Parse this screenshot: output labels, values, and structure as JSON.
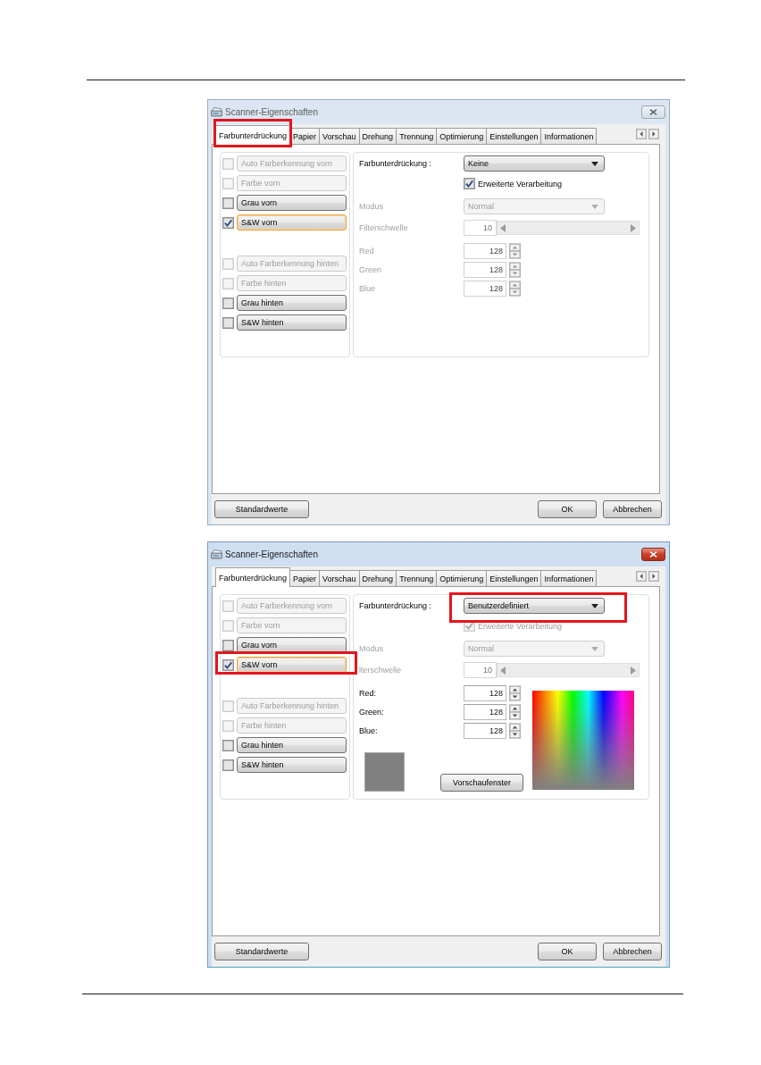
{
  "dialogs": [
    {
      "title": "Scanner-Eigenschaften",
      "active": false,
      "tabs": [
        {
          "label": "Farbunterdrückung",
          "selected": true,
          "highlighted": true
        },
        {
          "label": "Papier",
          "selected": false,
          "highlighted": false
        },
        {
          "label": "Vorschau",
          "selected": false,
          "highlighted": false
        },
        {
          "label": "Drehung",
          "selected": false,
          "highlighted": false
        },
        {
          "label": "Trennung",
          "selected": false,
          "highlighted": false
        },
        {
          "label": "Optimierung",
          "selected": false,
          "highlighted": false
        },
        {
          "label": "Einstellungen",
          "selected": false,
          "highlighted": false
        },
        {
          "label": "Informationen",
          "selected": false,
          "highlighted": false
        }
      ],
      "option_groups": [
        {
          "items": [
            {
              "label": "Auto Farberkennung vorn",
              "checked": false,
              "disabled": true,
              "focused": false,
              "highlighted": false
            },
            {
              "label": "Farbe vorn",
              "checked": false,
              "disabled": true,
              "focused": false,
              "highlighted": false
            },
            {
              "label": "Grau vorn",
              "checked": false,
              "disabled": false,
              "focused": false,
              "highlighted": false
            },
            {
              "label": "S&W vorn",
              "checked": true,
              "disabled": false,
              "focused": true,
              "highlighted": false
            }
          ]
        },
        {
          "items": [
            {
              "label": "Auto Farberkennung hinten",
              "checked": false,
              "disabled": true,
              "focused": false,
              "highlighted": false
            },
            {
              "label": "Farbe hinten",
              "checked": false,
              "disabled": true,
              "focused": false,
              "highlighted": false
            },
            {
              "label": "Grau hinten",
              "checked": false,
              "disabled": false,
              "focused": false,
              "highlighted": false
            },
            {
              "label": "S&W hinten",
              "checked": false,
              "disabled": false,
              "focused": false,
              "highlighted": false
            }
          ]
        }
      ],
      "suppression": {
        "label": "Farbunterdrückung :",
        "value": "Keine",
        "highlighted": false
      },
      "advanced": {
        "label": "Erweiterte Verarbeitung",
        "checked": true,
        "disabled": false
      },
      "mode": {
        "label": "Modus",
        "value": "Normal",
        "disabled": true
      },
      "threshold": {
        "label": "Filterschwelle",
        "value": "10",
        "disabled": true
      },
      "channels": [
        {
          "label": "Red",
          "value": "128",
          "disabled": true
        },
        {
          "label": "Green",
          "value": "128",
          "disabled": true
        },
        {
          "label": "Blue",
          "value": "128",
          "disabled": true
        }
      ],
      "buttons": [
        "Standardwerte",
        "OK",
        "Abbrechen"
      ]
    },
    {
      "title": "Scanner-Eigenschaften",
      "active": true,
      "tabs": [
        {
          "label": "Farbunterdrückung",
          "selected": true,
          "highlighted": false
        },
        {
          "label": "Papier",
          "selected": false,
          "highlighted": false
        },
        {
          "label": "Vorschau",
          "selected": false,
          "highlighted": false
        },
        {
          "label": "Drehung",
          "selected": false,
          "highlighted": false
        },
        {
          "label": "Trennung",
          "selected": false,
          "highlighted": false
        },
        {
          "label": "Optimierung",
          "selected": false,
          "highlighted": false
        },
        {
          "label": "Einstellungen",
          "selected": false,
          "highlighted": false
        },
        {
          "label": "Informationen",
          "selected": false,
          "highlighted": false
        }
      ],
      "option_groups": [
        {
          "items": [
            {
              "label": "Auto Farberkennung vorn",
              "checked": false,
              "disabled": true,
              "focused": false,
              "highlighted": false
            },
            {
              "label": "Farbe vorn",
              "checked": false,
              "disabled": true,
              "focused": false,
              "highlighted": false
            },
            {
              "label": "Grau vorn",
              "checked": false,
              "disabled": false,
              "focused": false,
              "highlighted": false
            },
            {
              "label": "S&W vorn",
              "checked": true,
              "disabled": false,
              "focused": true,
              "highlighted": true
            }
          ]
        },
        {
          "items": [
            {
              "label": "Auto Farberkennung hinten",
              "checked": false,
              "disabled": true,
              "focused": false,
              "highlighted": false
            },
            {
              "label": "Farbe hinten",
              "checked": false,
              "disabled": true,
              "focused": false,
              "highlighted": false
            },
            {
              "label": "Grau hinten",
              "checked": false,
              "disabled": false,
              "focused": false,
              "highlighted": false
            },
            {
              "label": "S&W hinten",
              "checked": false,
              "disabled": false,
              "focused": false,
              "highlighted": false
            }
          ]
        }
      ],
      "suppression": {
        "label": "Farbunterdrückung :",
        "value": "Benutzerdefiniert",
        "highlighted": true
      },
      "advanced": {
        "label": "Erweiterte Verarbeitung",
        "checked": true,
        "disabled": true
      },
      "mode": {
        "label": "Modus",
        "value": "Normal",
        "disabled": true
      },
      "threshold": {
        "label": "lterschwelle",
        "value": "10",
        "disabled": true
      },
      "channels": [
        {
          "label": "Red:",
          "value": "128",
          "disabled": false
        },
        {
          "label": "Green:",
          "value": "128",
          "disabled": false
        },
        {
          "label": "Blue:",
          "value": "128",
          "disabled": false
        }
      ],
      "preview_button": "Vorschaufenster",
      "buttons": [
        "Standardwerte",
        "OK",
        "Abbrechen"
      ]
    }
  ]
}
